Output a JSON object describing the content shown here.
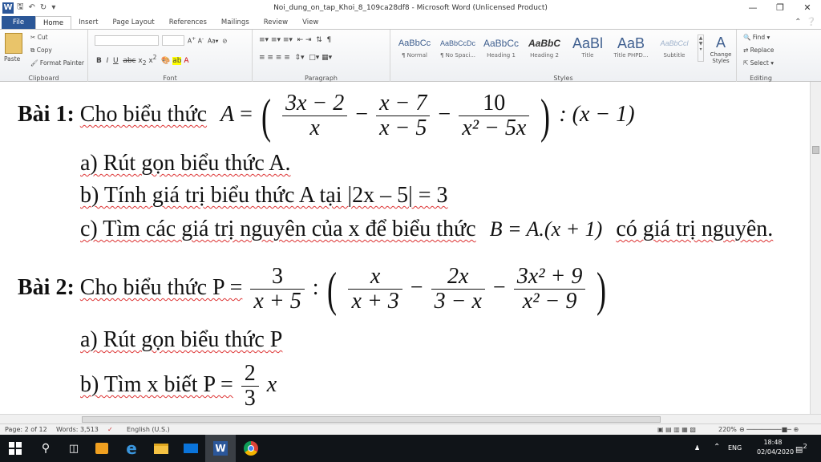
{
  "window": {
    "title": "Noi_dung_on_tap_Khoi_8_109ca28df8  -  Microsoft Word (Unlicensed Product)",
    "app_icon": "W",
    "quick_access": [
      "save-icon",
      "undo-icon",
      "redo-icon",
      "customize-icon"
    ],
    "controls": [
      "minimize-icon",
      "restore-icon",
      "close-icon"
    ]
  },
  "tabs": [
    "File",
    "Home",
    "Insert",
    "Page Layout",
    "References",
    "Mailings",
    "Review",
    "View"
  ],
  "active_tab": "Home",
  "ribbon": {
    "clipboard": {
      "label": "Clipboard",
      "paste": "Paste",
      "cut": "Cut",
      "copy": "Copy",
      "format_painter": "Format Painter"
    },
    "font": {
      "label": "Font",
      "name": "",
      "size": ""
    },
    "paragraph": {
      "label": "Paragraph"
    },
    "styles": {
      "label": "Styles",
      "items": [
        {
          "sample": "AaBbCc",
          "name": "¶ Normal"
        },
        {
          "sample": "AaBbCcDc",
          "name": "¶ No Spaci..."
        },
        {
          "sample": "AaBbCc",
          "name": "Heading 1"
        },
        {
          "sample": "AaBbC",
          "name": "Heading 2"
        },
        {
          "sample": "AaBl",
          "name": "Title"
        },
        {
          "sample": "AaB",
          "name": "Title PHPD..."
        },
        {
          "sample": "AaBbCcl",
          "name": "Subtitle"
        }
      ],
      "change_styles": "Change Styles"
    },
    "editing": {
      "label": "Editing",
      "find": "Find",
      "replace": "Replace",
      "select": "Select"
    }
  },
  "document": {
    "bai1": {
      "label": "Bài 1:",
      "intro": "Cho biểu thức",
      "expr_A": "A",
      "f1_num": "3x − 2",
      "f1_den": "x",
      "f2_num": "x − 7",
      "f2_den": "x − 5",
      "f3_num": "10",
      "f3_den": "x² − 5x",
      "tail": ": (x − 1)",
      "a": "a) Rút gọn biểu thức A.",
      "b": "b) Tính giá trị biểu thức A tại |2x – 5| = 3",
      "c_pre": "c) Tìm các giá trị nguyên của x để biểu thức",
      "c_expr": "B = A.(x + 1)",
      "c_post": "có giá trị nguyên."
    },
    "bai2": {
      "label": "Bài 2:",
      "intro": "Cho biểu thức P =",
      "g1_num": "3",
      "g1_den": "x + 5",
      "g2_num": "x",
      "g2_den": "x + 3",
      "g3_num": "2x",
      "g3_den": "3 − x",
      "g4_num": "3x² + 9",
      "g4_den": "x² − 9",
      "a": "a) Rút gọn biểu thức P",
      "b_pre": "b) Tìm x biết P =",
      "b_num": "2",
      "b_den": "3",
      "b_var": "x"
    }
  },
  "status": {
    "page": "Page: 2 of 12",
    "words": "Words: 3,513",
    "language": "English (U.S.)",
    "zoom": "220%"
  },
  "taskbar": {
    "icons": [
      "windows-start-icon",
      "search-icon",
      "task-view-icon",
      "store-icon",
      "edge-icon",
      "file-explorer-icon",
      "mail-icon",
      "word-icon",
      "chrome-icon"
    ],
    "language": "ENG",
    "time": "18:48",
    "date": "02/04/2020",
    "notifications": "2"
  }
}
